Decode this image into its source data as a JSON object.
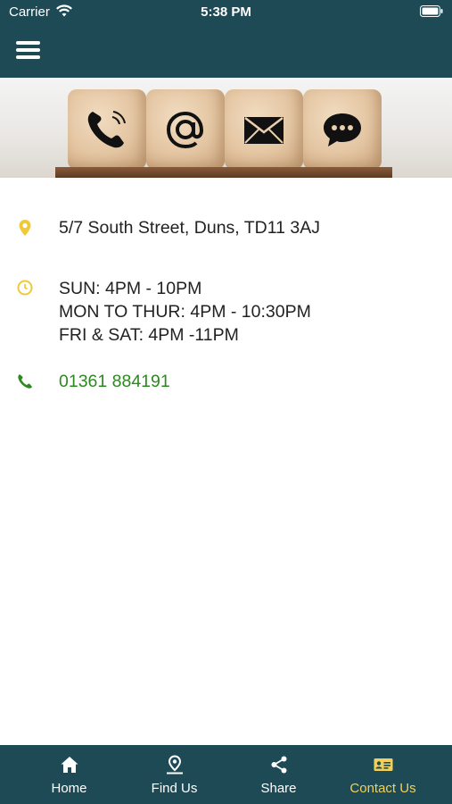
{
  "status_bar": {
    "carrier": "Carrier",
    "time": "5:38 PM"
  },
  "header": {
    "menu_icon": "hamburger-icon"
  },
  "banner": {
    "icons": [
      "phone-icon",
      "at-sign-icon",
      "envelope-icon",
      "chat-bubble-icon"
    ]
  },
  "contact": {
    "address": "5/7 South Street, Duns, TD11 3AJ",
    "hours": [
      "SUN: 4PM - 10PM",
      "MON TO THUR: 4PM - 10:30PM",
      "FRI & SAT: 4PM -11PM"
    ],
    "phone": "01361 884191"
  },
  "tabs": [
    {
      "label": "Home",
      "icon": "home-icon"
    },
    {
      "label": "Find Us",
      "icon": "location-pin-icon"
    },
    {
      "label": "Share",
      "icon": "share-icon"
    },
    {
      "label": "Contact Us",
      "icon": "contact-card-icon"
    }
  ],
  "colors": {
    "primary": "#1d4a55",
    "accent": "#f0d05a",
    "link": "#2b8a1e"
  }
}
